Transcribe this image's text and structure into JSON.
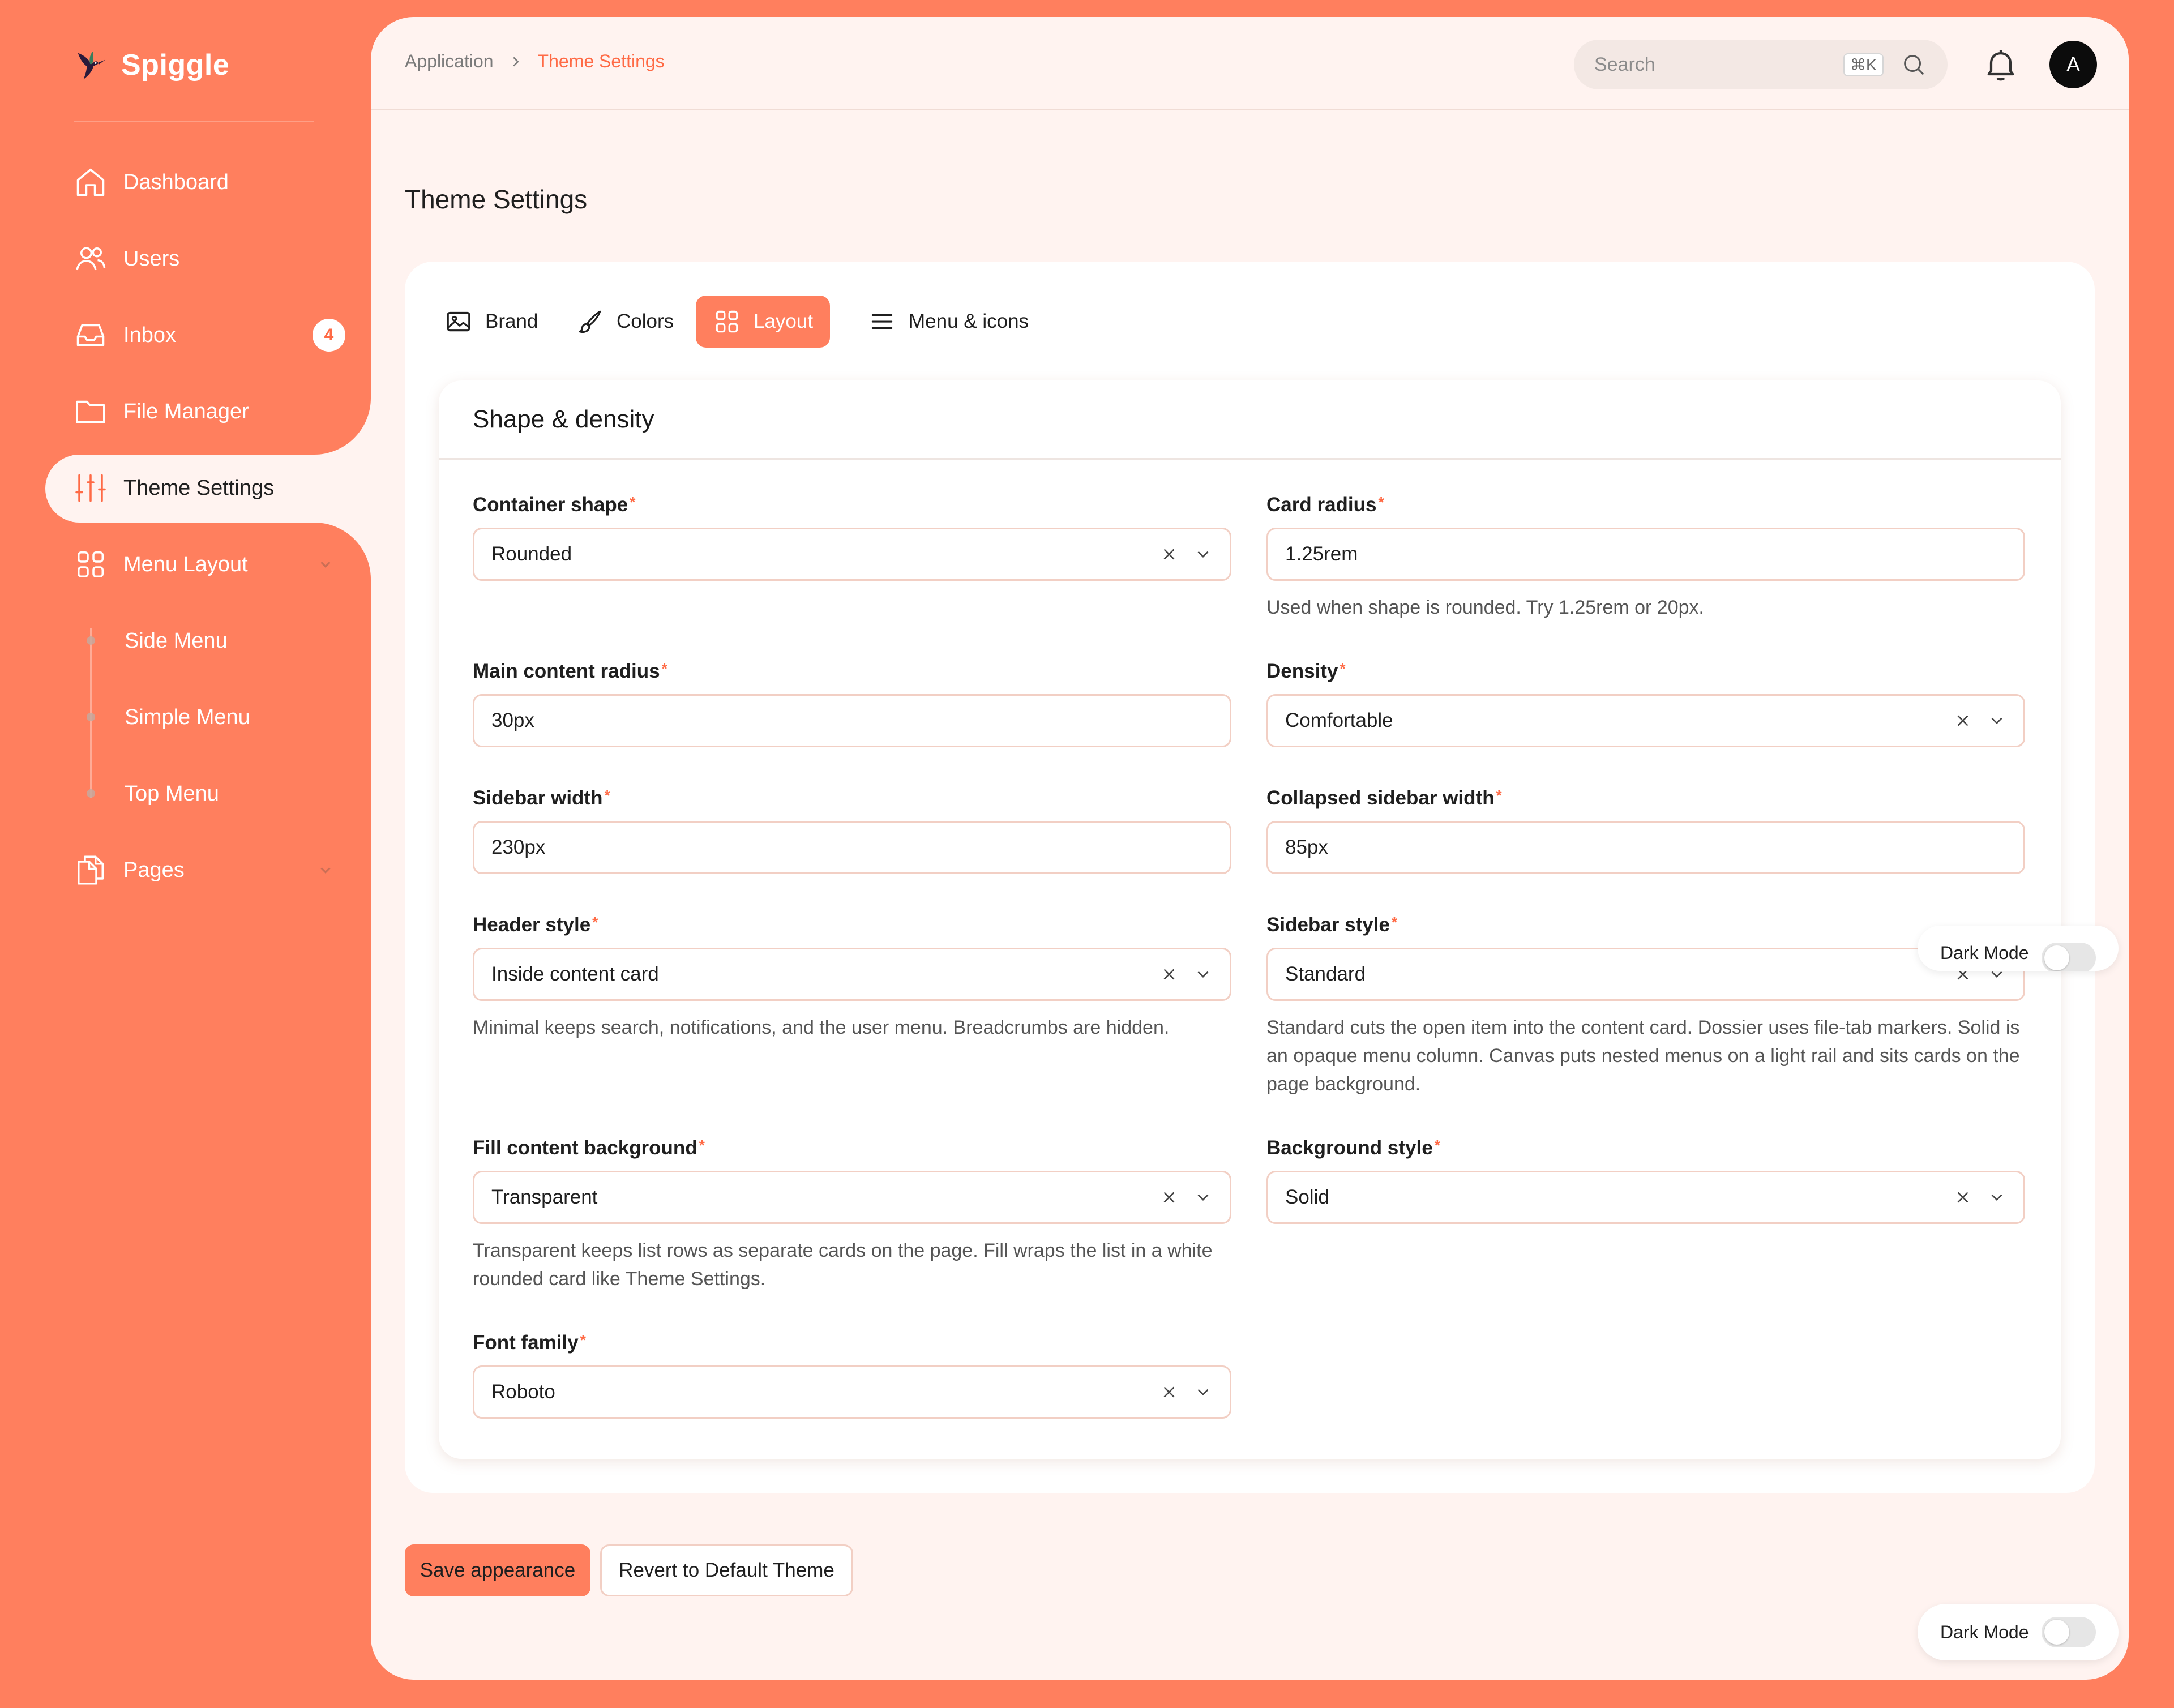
{
  "brand": {
    "name": "Spiggle"
  },
  "sidebar": {
    "items": [
      {
        "label": "Dashboard",
        "icon": "home-icon"
      },
      {
        "label": "Users",
        "icon": "users-icon"
      },
      {
        "label": "Inbox",
        "icon": "inbox-icon",
        "badge": "4"
      },
      {
        "label": "File Manager",
        "icon": "folder-icon"
      },
      {
        "label": "Theme Settings",
        "icon": "sliders-icon",
        "active": true
      },
      {
        "label": "Menu Layout",
        "icon": "grid-icon",
        "expanded": true
      },
      {
        "label": "Pages",
        "icon": "pages-icon"
      }
    ],
    "submenu": [
      "Side Menu",
      "Simple Menu",
      "Top Menu"
    ]
  },
  "header": {
    "breadcrumb": {
      "root": "Application",
      "current": "Theme Settings"
    },
    "search": {
      "placeholder": "Search",
      "shortcut": "⌘K"
    },
    "avatar_initial": "A"
  },
  "page": {
    "title": "Theme Settings"
  },
  "tabs": [
    {
      "label": "Brand",
      "icon": "image-icon"
    },
    {
      "label": "Colors",
      "icon": "brush-icon"
    },
    {
      "label": "Layout",
      "icon": "grid-icon",
      "active": true
    },
    {
      "label": "Menu & icons",
      "icon": "menu-icon"
    }
  ],
  "section": {
    "title": "Shape & density",
    "fields": {
      "container_shape": {
        "label": "Container shape",
        "value": "Rounded"
      },
      "card_radius": {
        "label": "Card radius",
        "value": "1.25rem",
        "help": "Used when shape is rounded. Try 1.25rem or 20px."
      },
      "main_content_radius": {
        "label": "Main content radius",
        "value": "30px"
      },
      "density": {
        "label": "Density",
        "value": "Comfortable"
      },
      "sidebar_width": {
        "label": "Sidebar width",
        "value": "230px"
      },
      "collapsed_sidebar_width": {
        "label": "Collapsed sidebar width",
        "value": "85px"
      },
      "header_style": {
        "label": "Header style",
        "value": "Inside content card",
        "help": "Minimal keeps search, notifications, and the user menu. Breadcrumbs are hidden."
      },
      "sidebar_style": {
        "label": "Sidebar style",
        "value": "Standard",
        "help": "Standard cuts the open item into the content card. Dossier uses file-tab markers. Solid is an opaque menu column. Canvas puts nested menus on a light rail and sits cards on the page background."
      },
      "fill_content_background": {
        "label": "Fill content background",
        "value": "Transparent",
        "help": "Transparent keeps list rows as separate cards on the page. Fill wraps the list in a white rounded card like Theme Settings."
      },
      "background_style": {
        "label": "Background style",
        "value": "Solid"
      },
      "font_family": {
        "label": "Font family",
        "value": "Roboto"
      }
    }
  },
  "actions": {
    "save": "Save appearance",
    "revert": "Revert to Default Theme"
  },
  "dark_mode": {
    "label": "Dark Mode",
    "enabled": false
  },
  "colors": {
    "accent": "#ff7f5e",
    "surface": "#fff3f0",
    "required": "#ff6a45"
  }
}
